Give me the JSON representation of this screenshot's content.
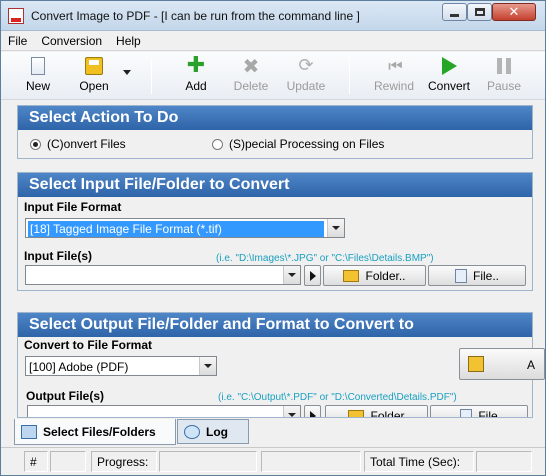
{
  "window": {
    "title": "Convert Image to PDF - [I can be run from the command line ]",
    "close_glyph": "✕"
  },
  "menu": [
    "File",
    "Conversion",
    "Help"
  ],
  "toolbar": {
    "new": "New",
    "open": "Open",
    "add": "Add",
    "delete": "Delete",
    "update": "Update",
    "rewind": "Rewind",
    "convert": "Convert",
    "pause": "Pause",
    "add_glyph": "✚",
    "delete_glyph": "✖",
    "update_glyph": "⟳",
    "rewind_glyph": "⏮"
  },
  "action_section": {
    "header": "Select Action To Do",
    "convert_files": "(C)onvert Files",
    "special_processing": "(S)pecial Processing on Files",
    "selected": "convert_files"
  },
  "input_section": {
    "header": "Select Input File/Folder to Convert",
    "format_label": "Input File Format",
    "format_value": "[18] Tagged Image File Format (*.tif)",
    "files_label": "Input File(s)",
    "files_hint": "(i.e. \"D:\\Images\\*.JPG\" or \"C:\\Files\\Details.BMP\")",
    "files_value": "",
    "folder_button": "Folder..",
    "file_button": "File.."
  },
  "output_section": {
    "header": "Select Output File/Folder and Format to Convert to",
    "format_label": "Convert to File Format",
    "format_value": "[100] Adobe (PDF)",
    "side_button": "A",
    "files_label": "Output File(s)",
    "files_hint": "(i.e. \"C:\\Output\\*.PDF\" or \"D:\\Converted\\Details.PDF\")",
    "files_value": "",
    "folder_button": "Folder",
    "file_button": "File"
  },
  "tabs": {
    "select_files": "Select Files/Folders",
    "log": "Log"
  },
  "status": {
    "count_label": "#",
    "progress_label": "Progress:",
    "total_time_label": "Total Time (Sec):"
  }
}
